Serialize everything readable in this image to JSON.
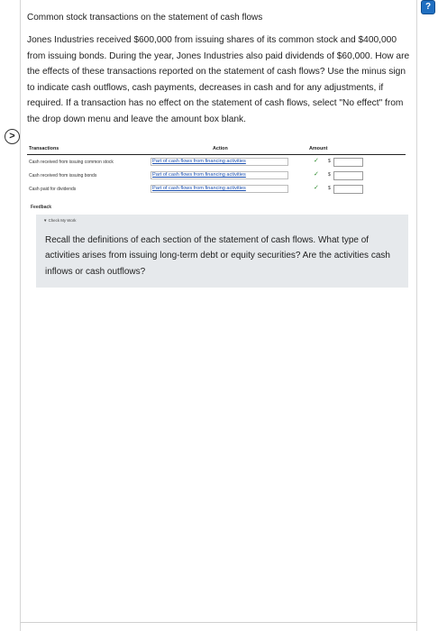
{
  "title": "Common stock transactions on the statement of cash flows",
  "question": "Jones Industries received $600,000 from issuing shares of its common stock and $400,000 from issuing bonds. During the year, Jones Industries also paid dividends of $60,000. How are the effects of these transactions reported on the statement of cash flows? Use the minus sign to indicate cash outflows, cash payments, decreases in cash and for any adjustments, if required. If a transaction has no effect on the statement of cash flows, select \"No effect\" from the drop down menu and leave the amount box blank.",
  "help_icon": "?",
  "nav_arrow": ">",
  "table": {
    "headers": {
      "transactions": "Transactions",
      "action": "Action",
      "amount": "Amount"
    },
    "rows": [
      {
        "label": "Cash received from issuing common stock",
        "action": "Part of cash flows from financing activities",
        "check": "✓",
        "currency": "$",
        "amount": ""
      },
      {
        "label": "Cash received from issuing bonds",
        "action": "Part of cash flows from financing activities",
        "check": "✓",
        "currency": "$",
        "amount": ""
      },
      {
        "label": "Cash paid for dividends",
        "action": "Part of cash flows from financing activities",
        "check": "✓",
        "currency": "$",
        "amount": ""
      }
    ]
  },
  "feedback": {
    "label": "Feedback",
    "check_work": "▼ Check My Work",
    "text": "Recall the definitions of each section of the statement of cash flows. What type of activities arises from issuing long-term debt or equity securities? Are the activities cash inflows or cash outflows?"
  },
  "colors": {
    "link": "#1a4fb0",
    "check": "#2e8b2e",
    "feedback_bg": "#e6e9ec",
    "help_icon": "#1f6fc1"
  }
}
